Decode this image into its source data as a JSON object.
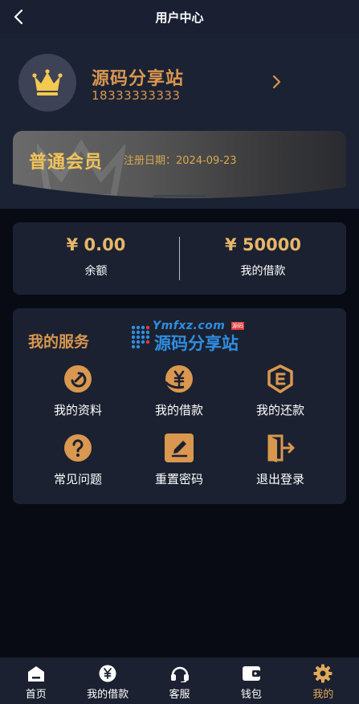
{
  "header": {
    "title": "用户中心",
    "back_icon": "chevron-left-icon"
  },
  "profile": {
    "name": "源码分享站",
    "phone": "18333333333",
    "avatar_icon": "crown-icon",
    "arrow_icon": "chevron-right-icon"
  },
  "member": {
    "level": "普通会员",
    "date_label": "注册日期：",
    "date_value": "2024-09-23"
  },
  "balance": {
    "items": [
      {
        "amount": "¥ 0.00",
        "label": "余额"
      },
      {
        "amount": "¥ 50000",
        "label": "我的借款"
      }
    ]
  },
  "services": {
    "title": "我的服务",
    "logo_url_text": "Ymfxz.com",
    "logo_tag": "源码",
    "logo_text": "源码分享站",
    "items": [
      {
        "label": "我的资料",
        "icon": "profile-edit-icon"
      },
      {
        "label": "我的借款",
        "icon": "yen-loan-icon"
      },
      {
        "label": "我的还款",
        "icon": "repay-shield-icon"
      },
      {
        "label": "常见问题",
        "icon": "question-icon"
      },
      {
        "label": "重置密码",
        "icon": "pencil-edit-icon"
      },
      {
        "label": "退出登录",
        "icon": "logout-icon"
      }
    ]
  },
  "nav": {
    "items": [
      {
        "label": "首页",
        "icon": "home-icon"
      },
      {
        "label": "我的借款",
        "icon": "yen-circle-icon"
      },
      {
        "label": "客服",
        "icon": "headset-icon"
      },
      {
        "label": "钱包",
        "icon": "wallet-icon"
      },
      {
        "label": "我的",
        "icon": "gear-icon"
      }
    ],
    "active_index": 4
  },
  "colors": {
    "accent": "#d9974f",
    "gold": "#e6b66a",
    "card_bg": "#1b2130",
    "page_bg": "#080b14"
  }
}
